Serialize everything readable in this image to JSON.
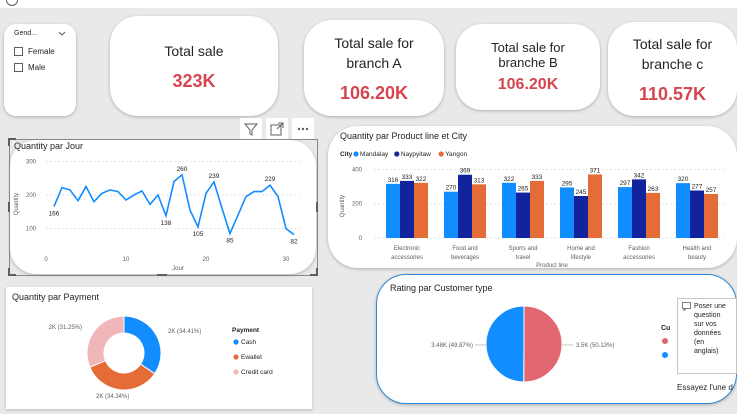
{
  "slicer": {
    "title": "Gend...",
    "items": [
      "Female",
      "Male"
    ]
  },
  "kpis": [
    {
      "title": "Total sale",
      "value": "323K"
    },
    {
      "title": "Total sale for branch A",
      "value": "106.20K"
    },
    {
      "title": "Total sale for branche B",
      "value": "106.20K"
    },
    {
      "title": "Total sale for branche c",
      "value": "110.57K"
    }
  ],
  "line_title": "Quantity par Jour",
  "line_ylabel": "Quantity",
  "line_xlabel": "Jour",
  "bar_title": "Quantity par Product line et City",
  "bar_legend_title": "City",
  "bar_xlabel": "Product line",
  "bar_ylabel": "Quantity",
  "donut1_title": "Quantity par Payment",
  "donut1_legend_title": "Payment",
  "donut2_title": "Rating par Customer type",
  "qa": {
    "text": "Poser une question sur vos données (en anglais)",
    "footer": "Essayez l'une d"
  },
  "legend_partial": "Cu",
  "chart_data": [
    {
      "type": "line",
      "title": "Quantity par Jour",
      "xlabel": "Jour",
      "ylabel": "Quantity",
      "x": [
        1,
        2,
        3,
        4,
        5,
        6,
        7,
        8,
        9,
        10,
        11,
        12,
        13,
        14,
        15,
        16,
        17,
        18,
        19,
        20,
        21,
        22,
        23,
        24,
        25,
        26,
        27,
        28,
        29,
        30,
        31
      ],
      "y": [
        166,
        222,
        215,
        183,
        225,
        180,
        205,
        215,
        210,
        185,
        200,
        212,
        172,
        200,
        138,
        240,
        260,
        155,
        105,
        205,
        239,
        160,
        85,
        140,
        195,
        210,
        210,
        229,
        195,
        100,
        82,
        100,
        100
      ],
      "xticks": [
        0,
        10,
        20,
        30
      ],
      "yticks": [
        100,
        200,
        300
      ],
      "ylim": [
        60,
        310
      ],
      "data_labels": [
        {
          "x": 1,
          "label": "166"
        },
        {
          "x": 15,
          "label": "138"
        },
        {
          "x": 17,
          "label": "260"
        },
        {
          "x": 19,
          "label": "105"
        },
        {
          "x": 21,
          "label": "239"
        },
        {
          "x": 23,
          "label": "85"
        },
        {
          "x": 28,
          "label": "229"
        },
        {
          "x": 31,
          "label": "82"
        }
      ],
      "color": "#118dff"
    },
    {
      "type": "bar",
      "title": "Quantity par Product line et City",
      "xlabel": "Product line",
      "ylabel": "Quantity",
      "categories": [
        "Electronic accessories",
        "Food and beverages",
        "Sports and travel",
        "Home and lifestyle",
        "Fashion accessories",
        "Health and beauty"
      ],
      "series": [
        {
          "name": "Mandalay",
          "color": "#118dff",
          "values": [
            316,
            270,
            322,
            295,
            297,
            320
          ]
        },
        {
          "name": "Naypyitaw",
          "color": "#12239e",
          "values": [
            333,
            369,
            265,
            245,
            342,
            277
          ]
        },
        {
          "name": "Yangon",
          "color": "#e66c37",
          "values": [
            322,
            313,
            333,
            371,
            263,
            257
          ]
        }
      ],
      "yticks": [
        0,
        200,
        400
      ],
      "ylim": [
        0,
        420
      ]
    },
    {
      "type": "pie",
      "title": "Quantity par Payment",
      "labels": [
        "Cash",
        "Ewallet",
        "Credit card"
      ],
      "values": [
        34.41,
        34.34,
        31.25
      ],
      "data_labels": [
        "2K (34.41%)",
        "2K (34.34%)",
        "2K (31.25%)"
      ],
      "colors": [
        "#118dff",
        "#e66c37",
        "#f0b6ba"
      ],
      "donut": true
    },
    {
      "type": "pie",
      "title": "Rating par Customer type",
      "values": [
        50.13,
        49.87
      ],
      "data_labels": [
        "3.5K (50.13%)",
        "3.48K (49.87%)"
      ],
      "colors": [
        "#e06670",
        "#118dff"
      ]
    }
  ]
}
